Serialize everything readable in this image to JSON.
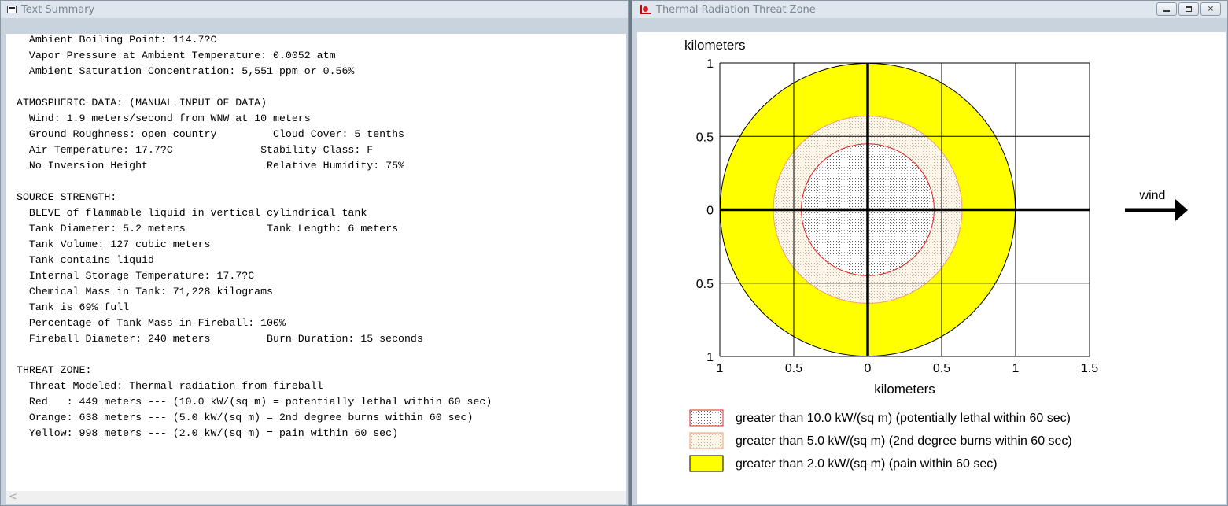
{
  "left_window": {
    "title": "Text Summary",
    "lines": [
      "  Ambient Boiling Point: 114.7?C",
      "  Vapor Pressure at Ambient Temperature: 0.0052 atm",
      "  Ambient Saturation Concentration: 5,551 ppm or 0.56%",
      "",
      "ATMOSPHERIC DATA: (MANUAL INPUT OF DATA)",
      "  Wind: 1.9 meters/second from WNW at 10 meters",
      "  Ground Roughness: open country         Cloud Cover: 5 tenths",
      "  Air Temperature: 17.7?C              Stability Class: F",
      "  No Inversion Height                   Relative Humidity: 75%",
      "",
      "SOURCE STRENGTH:",
      "  BLEVE of flammable liquid in vertical cylindrical tank",
      "  Tank Diameter: 5.2 meters             Tank Length: 6 meters",
      "  Tank Volume: 127 cubic meters",
      "  Tank contains liquid",
      "  Internal Storage Temperature: 17.7?C",
      "  Chemical Mass in Tank: 71,228 kilograms",
      "  Tank is 69% full",
      "  Percentage of Tank Mass in Fireball: 100%",
      "  Fireball Diameter: 240 meters         Burn Duration: 15 seconds",
      "",
      "THREAT ZONE:",
      "  Threat Modeled: Thermal radiation from fireball",
      "  Red   : 449 meters --- (10.0 kW/(sq m) = potentially lethal within 60 sec)",
      "  Orange: 638 meters --- (5.0 kW/(sq m) = 2nd degree burns within 60 sec)",
      "  Yellow: 998 meters --- (2.0 kW/(sq m) = pain within 60 sec)"
    ],
    "scroll_left_glyph": "<"
  },
  "right_window": {
    "title": "Thermal Radiation Threat Zone",
    "controls": {
      "minimize": "minimize",
      "maximize": "maximize",
      "close": "✕"
    }
  },
  "chart_data": {
    "type": "threat-zone",
    "y_axis_title": "kilometers",
    "x_axis_title": "kilometers",
    "x_ticks": [
      {
        "value": -1,
        "label": "1"
      },
      {
        "value": -0.5,
        "label": "0.5"
      },
      {
        "value": 0,
        "label": "0"
      },
      {
        "value": 0.5,
        "label": "0.5"
      },
      {
        "value": 1,
        "label": "1"
      },
      {
        "value": 1.5,
        "label": "1.5"
      }
    ],
    "y_ticks": [
      {
        "value": 1,
        "label": "1"
      },
      {
        "value": 0.5,
        "label": "0.5"
      },
      {
        "value": 0,
        "label": "0"
      },
      {
        "value": -0.5,
        "label": "0.5"
      },
      {
        "value": -1,
        "label": "1"
      }
    ],
    "xlim": [
      -1,
      1.5
    ],
    "ylim": [
      -1,
      1
    ],
    "grid": true,
    "zones": [
      {
        "name": "yellow",
        "radius_km": 0.998,
        "color": "#ffff00",
        "stroke": "#000000",
        "pattern": "solid"
      },
      {
        "name": "orange",
        "radius_km": 0.638,
        "color": "#fde5c8",
        "stroke": "#f0a070",
        "pattern": "dots-orange"
      },
      {
        "name": "red",
        "radius_km": 0.449,
        "color": "#ffeaea",
        "stroke": "#e02020",
        "pattern": "dots-red"
      }
    ],
    "wind_label": "wind",
    "legend": [
      {
        "text": "greater than 10.0 kW/(sq m) (potentially lethal within 60 sec)",
        "pattern": "dots-red"
      },
      {
        "text": "greater than 5.0 kW/(sq m) (2nd degree burns within 60 sec)",
        "pattern": "dots-orange"
      },
      {
        "text": "greater than 2.0 kW/(sq m) (pain within 60 sec)",
        "pattern": "solid-yellow"
      }
    ]
  }
}
